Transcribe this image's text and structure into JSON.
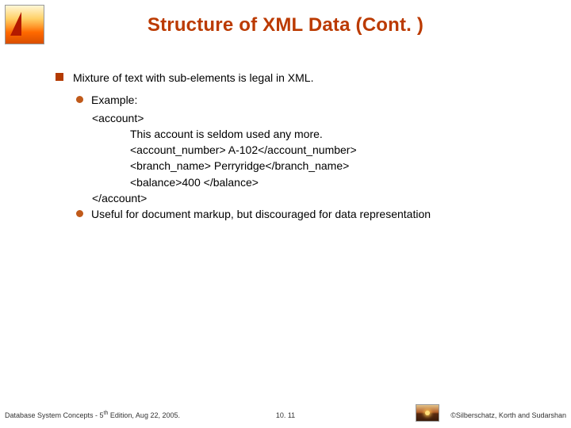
{
  "title": "Structure of XML Data (Cont. )",
  "bullets": {
    "l1_0": "Mixture of text with sub-elements is legal in XML.",
    "l2_0": "Example:",
    "code": {
      "l0": "<account>",
      "l1": "This account is seldom used any more.",
      "l2": "<account_number> A-102</account_number>",
      "l3": "<branch_name> Perryridge</branch_name>",
      "l4": "<balance>400 </balance>",
      "l5": "</account>"
    },
    "l2_1": "Useful for document markup, but discouraged for data representation"
  },
  "footer": {
    "left_pre": "Database System Concepts - 5",
    "left_sup": "th",
    "left_post": " Edition, Aug 22, 2005.",
    "center": "10. 11",
    "right": "©Silberschatz, Korth and Sudarshan"
  }
}
